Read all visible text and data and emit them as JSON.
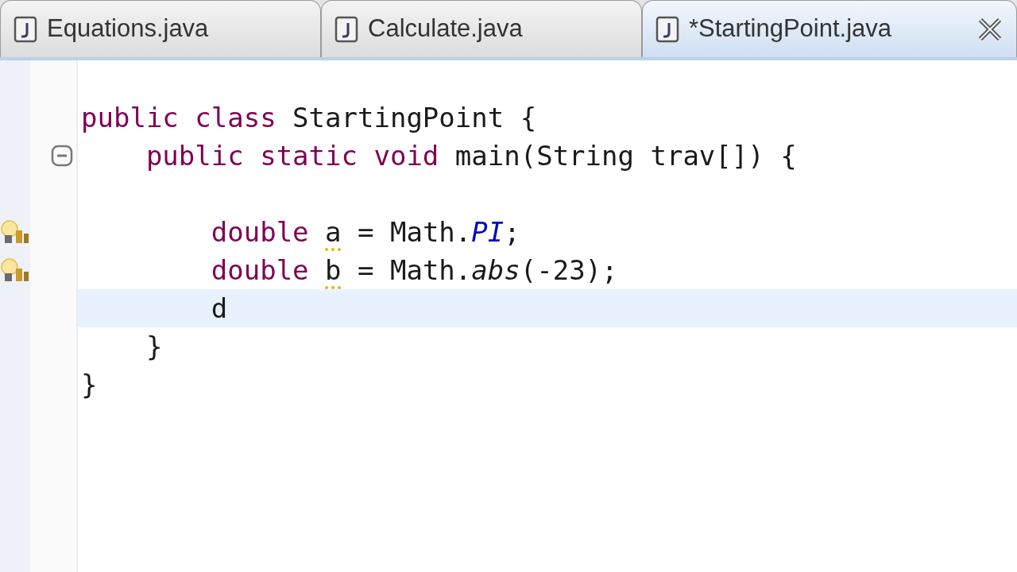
{
  "tabs": [
    {
      "label": "Equations.java",
      "selected": false
    },
    {
      "label": "Calculate.java",
      "selected": false
    },
    {
      "label": "*StartingPoint.java",
      "selected": true
    }
  ],
  "editor": {
    "lines": [
      {
        "current": false,
        "foldable": false,
        "warning": false
      },
      {
        "current": false,
        "foldable": false,
        "warning": false,
        "tokens": [
          {
            "text": "public class ",
            "kind": "keyword"
          },
          {
            "text": "StartingPoint {",
            "kind": "plain"
          }
        ]
      },
      {
        "current": false,
        "foldable": true,
        "warning": false,
        "tokens": [
          {
            "text": "    public static void ",
            "kind": "keyword"
          },
          {
            "text": "main(String trav[]) {",
            "kind": "plain"
          }
        ]
      },
      {
        "current": false,
        "foldable": false,
        "warning": false
      },
      {
        "current": false,
        "foldable": false,
        "warning": true,
        "tokens": [
          {
            "text": "        double ",
            "kind": "keyword"
          },
          {
            "text": "a",
            "kind": "unused"
          },
          {
            "text": " = Math.",
            "kind": "plain"
          },
          {
            "text": "PI",
            "kind": "static-field"
          },
          {
            "text": ";",
            "kind": "plain"
          }
        ]
      },
      {
        "current": false,
        "foldable": false,
        "warning": true,
        "tokens": [
          {
            "text": "        double ",
            "kind": "keyword"
          },
          {
            "text": "b",
            "kind": "unused"
          },
          {
            "text": " = Math.",
            "kind": "plain"
          },
          {
            "text": "abs",
            "kind": "static-method"
          },
          {
            "text": "(-23);",
            "kind": "plain"
          }
        ]
      },
      {
        "current": true,
        "foldable": false,
        "warning": false,
        "tokens": [
          {
            "text": "        d",
            "kind": "plain"
          }
        ]
      },
      {
        "current": false,
        "foldable": false,
        "warning": false,
        "tokens": [
          {
            "text": "    }",
            "kind": "plain"
          }
        ]
      },
      {
        "current": false,
        "foldable": false,
        "warning": false,
        "tokens": [
          {
            "text": "}",
            "kind": "plain"
          }
        ]
      }
    ]
  }
}
